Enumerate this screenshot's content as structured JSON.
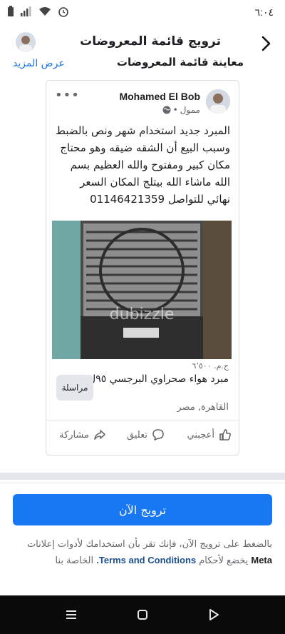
{
  "status_bar": {
    "time": "٦:٠٤",
    "icons": [
      "battery-icon",
      "signal-icon",
      "wifi-icon",
      "alarm-icon"
    ]
  },
  "header": {
    "title": "ترويج قائمة المعروضات",
    "back_icon": "chevron-right-icon"
  },
  "preview": {
    "title": "معاينة قائمة المعروضات",
    "see_more": "عرض المزيد"
  },
  "post": {
    "author": "Mohamed El Bob",
    "sponsored": "ممول",
    "privacy_icon": "globe-icon",
    "text": "المبرد جديد استخدام شهر ونص بالضبط وسبب البيع أن الشقه ضيقه وهو محتاج مكان كبير ومفتوح والله العظيم بسم الله ماشاء الله بيتلج المكان السعر نهائي للتواصل 01146421359",
    "photo_watermark": "dubizzle"
  },
  "listing": {
    "price": "ج.م. ٦٬٥٠٠",
    "title": "مبرد هواء صحراوي البرجسي ٩٥ل",
    "location": "القاهرة, مصر",
    "message_button": "مراسلة"
  },
  "actions": {
    "like": "أعجبني",
    "comment": "تعليق",
    "share": "مشاركة"
  },
  "promote_button": "ترويج الآن",
  "terms": {
    "part1": "بالضغط على ترويج الآن، فإنك تقر بأن استخدامك لأدوات إعلانات",
    "brand": "Meta",
    "part2": "يخضع لأحكام",
    "link": "Terms and Conditions.",
    "part3": "الخاصة بنا"
  },
  "colors": {
    "accent": "#1877f2",
    "link": "#1b74e4",
    "nav_bar": "#0a0a0a"
  }
}
